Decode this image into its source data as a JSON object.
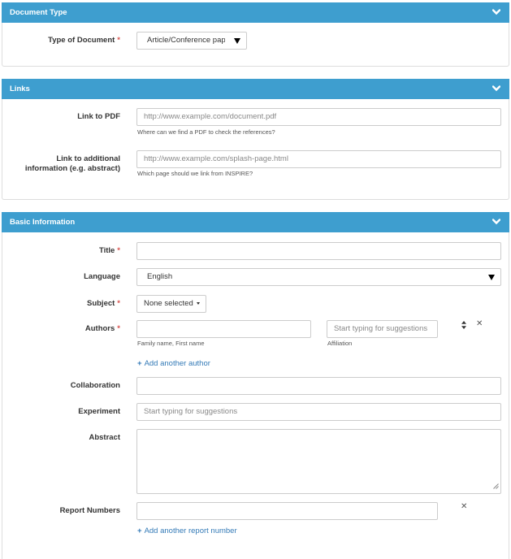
{
  "document_type": {
    "header": "Document Type",
    "type_label": "Type of Document",
    "type_required": "*",
    "type_value": "Article/Conference paper"
  },
  "links": {
    "header": "Links",
    "pdf_label": "Link to PDF",
    "pdf_placeholder": "http://www.example.com/document.pdf",
    "pdf_help": "Where can we find a PDF to check the references?",
    "additional_label_line1": "Link to additional",
    "additional_label_line2": "information (e.g. abstract)",
    "additional_placeholder": "http://www.example.com/splash-page.html",
    "additional_help": "Which page should we link from INSPIRE?"
  },
  "basic": {
    "header": "Basic Information",
    "title_label": "Title",
    "title_value": "",
    "language_label": "Language",
    "language_value": "English",
    "subject_label": "Subject",
    "subject_value": "None selected",
    "authors_label": "Authors",
    "author_name_value": "",
    "author_name_help": "Family name, First name",
    "affiliation_placeholder": "Start typing for suggestions",
    "affiliation_help": "Affiliation",
    "add_author": "Add another author",
    "collaboration_label": "Collaboration",
    "collaboration_value": "",
    "experiment_label": "Experiment",
    "experiment_placeholder": "Start typing for suggestions",
    "abstract_label": "Abstract",
    "abstract_value": "",
    "report_numbers_label": "Report Numbers",
    "report_number_value": "",
    "add_report_number": "Add another report number",
    "required_mark": "*"
  },
  "icons": {
    "collapse": "chevron-down-icon",
    "remove": "close-icon",
    "reorder": "sort-icon",
    "add": "plus-icon"
  },
  "colors": {
    "header_bg": "#3e9ecf",
    "required": "#d9534f",
    "link": "#337ab7"
  }
}
